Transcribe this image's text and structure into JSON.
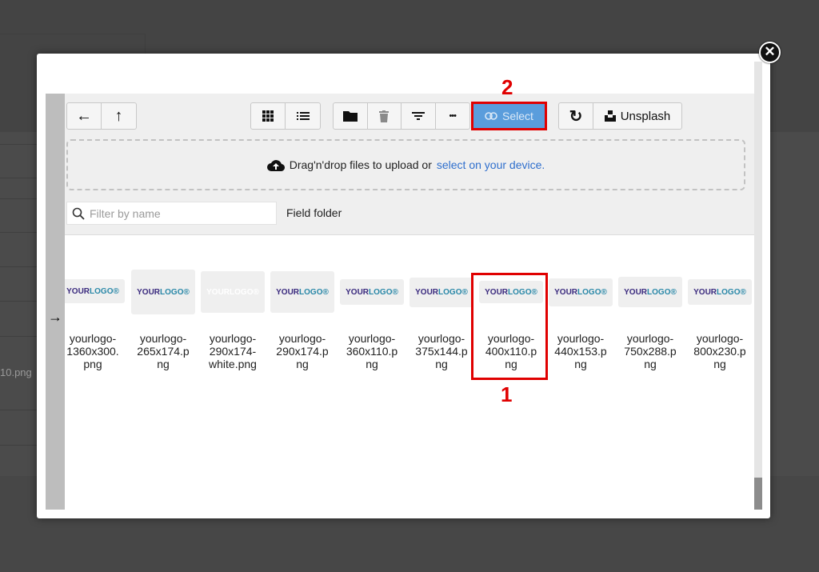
{
  "background": {
    "partial_filename": "10.png"
  },
  "modal": {
    "close_glyph": "✕"
  },
  "toolbar": {
    "back_icon": "←",
    "up_icon": "↑",
    "grid_icon": "grid-view-icon",
    "list_icon": "list-view-icon",
    "folder_icon": "folder-icon",
    "trash_icon": "trash-icon",
    "filter_icon": "filter-icon",
    "more_icon": "•••",
    "select_label": "Select",
    "refresh_icon": "↻",
    "unsplash_label": "Unsplash"
  },
  "dropzone": {
    "text": "Drag'n'drop files to upload or",
    "link": "select on your device."
  },
  "filter": {
    "placeholder": "Filter by name"
  },
  "folder_label": "Field folder",
  "files": [
    {
      "line1": "yourlogo-",
      "line2": "1360x300.",
      "line3": "png"
    },
    {
      "line1": "yourlogo-",
      "line2": "265x174.p",
      "line3": "ng"
    },
    {
      "line1": "yourlogo-",
      "line2": "290x174-",
      "line3": "white.png"
    },
    {
      "line1": "yourlogo-",
      "line2": "290x174.p",
      "line3": "ng"
    },
    {
      "line1": "yourlogo-",
      "line2": "360x110.p",
      "line3": "ng"
    },
    {
      "line1": "yourlogo-",
      "line2": "375x144.p",
      "line3": "ng"
    },
    {
      "line1": "yourlogo-",
      "line2": "400x110.p",
      "line3": "ng"
    },
    {
      "line1": "yourlogo-",
      "line2": "440x153.p",
      "line3": "ng"
    },
    {
      "line1": "yourlogo-",
      "line2": "750x288.p",
      "line3": "ng"
    },
    {
      "line1": "yourlogo-",
      "line2": "800x230.p",
      "line3": "ng"
    }
  ],
  "logo": {
    "part_a": "YOUR",
    "part_b": "LOGO",
    "mark": "®"
  },
  "annotations": {
    "file_step": "1",
    "select_step": "2"
  },
  "colors": {
    "select_button": "#5a9ddc",
    "annotation_red": "#e00000",
    "link_blue": "#2f6fcd"
  }
}
